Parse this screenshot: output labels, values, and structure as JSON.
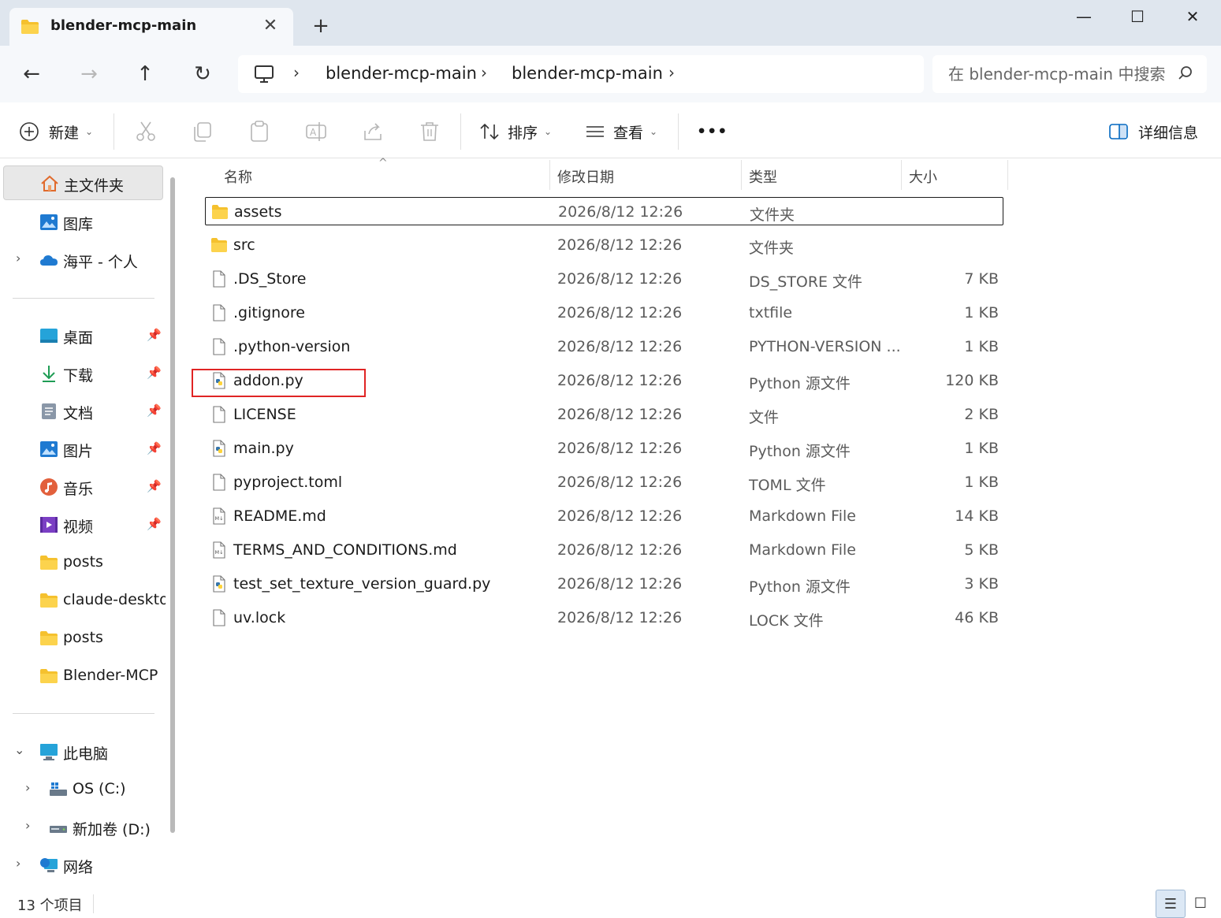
{
  "window": {
    "tab_title": "blender-mcp-main",
    "tab_close": "✕",
    "new_tab": "+",
    "minimize": "—",
    "maximize": "☐",
    "close": "✕"
  },
  "nav": {
    "back": "←",
    "forward": "→",
    "up": "↑",
    "refresh": "↻",
    "breadcrumbs": [
      "blender-mcp-main",
      "blender-mcp-main"
    ],
    "sep": "›",
    "search_placeholder": "在 blender-mcp-main 中搜索"
  },
  "toolbar": {
    "new_label": "新建",
    "sort_label": "排序",
    "view_label": "查看",
    "more_label": "•••",
    "details_label": "详细信息",
    "caret": "⌄"
  },
  "sidebar": {
    "home": "主文件夹",
    "gallery": "图库",
    "onedrive": "海平 - 个人",
    "quick": [
      {
        "label": "桌面",
        "icon": "desktop-icon"
      },
      {
        "label": "下载",
        "icon": "download-icon"
      },
      {
        "label": "文档",
        "icon": "document-icon"
      },
      {
        "label": "图片",
        "icon": "pictures-icon"
      },
      {
        "label": "音乐",
        "icon": "music-icon"
      },
      {
        "label": "视频",
        "icon": "video-icon"
      }
    ],
    "folders": [
      "posts",
      "claude-desktop",
      "posts",
      "Blender-MCP"
    ],
    "this_pc": "此电脑",
    "drive_c": "OS (C:)",
    "drive_d": "新加卷 (D:)",
    "network": "网络",
    "pin": "📌"
  },
  "columns": {
    "name": "名称",
    "modified": "修改日期",
    "type": "类型",
    "size": "大小"
  },
  "files": [
    {
      "name": "assets",
      "date": "2026/8/12 12:26",
      "type": "文件夹",
      "size": "",
      "icon": "folder"
    },
    {
      "name": "src",
      "date": "2026/8/12 12:26",
      "type": "文件夹",
      "size": "",
      "icon": "folder"
    },
    {
      "name": ".DS_Store",
      "date": "2026/8/12 12:26",
      "type": "DS_STORE 文件",
      "size": "7 KB",
      "icon": "file"
    },
    {
      "name": ".gitignore",
      "date": "2026/8/12 12:26",
      "type": "txtfile",
      "size": "1 KB",
      "icon": "file"
    },
    {
      "name": ".python-version",
      "date": "2026/8/12 12:26",
      "type": "PYTHON-VERSION ...",
      "size": "1 KB",
      "icon": "file"
    },
    {
      "name": "addon.py",
      "date": "2026/8/12 12:26",
      "type": "Python 源文件",
      "size": "120 KB",
      "icon": "python"
    },
    {
      "name": "LICENSE",
      "date": "2026/8/12 12:26",
      "type": "文件",
      "size": "2 KB",
      "icon": "file"
    },
    {
      "name": "main.py",
      "date": "2026/8/12 12:26",
      "type": "Python 源文件",
      "size": "1 KB",
      "icon": "python"
    },
    {
      "name": "pyproject.toml",
      "date": "2026/8/12 12:26",
      "type": "TOML 文件",
      "size": "1 KB",
      "icon": "file"
    },
    {
      "name": "README.md",
      "date": "2026/8/12 12:26",
      "type": "Markdown File",
      "size": "14 KB",
      "icon": "markdown"
    },
    {
      "name": "TERMS_AND_CONDITIONS.md",
      "date": "2026/8/12 12:26",
      "type": "Markdown File",
      "size": "5 KB",
      "icon": "markdown"
    },
    {
      "name": "test_set_texture_version_guard.py",
      "date": "2026/8/12 12:26",
      "type": "Python 源文件",
      "size": "3 KB",
      "icon": "python"
    },
    {
      "name": "uv.lock",
      "date": "2026/8/12 12:26",
      "type": "LOCK 文件",
      "size": "46 KB",
      "icon": "file"
    }
  ],
  "status": {
    "count": "13 个项目",
    "details_view": "☰",
    "tiles_view": "☐"
  },
  "colors": {
    "highlight": "#e02424",
    "folder": "#f5c12e",
    "accent": "#0067c0"
  }
}
